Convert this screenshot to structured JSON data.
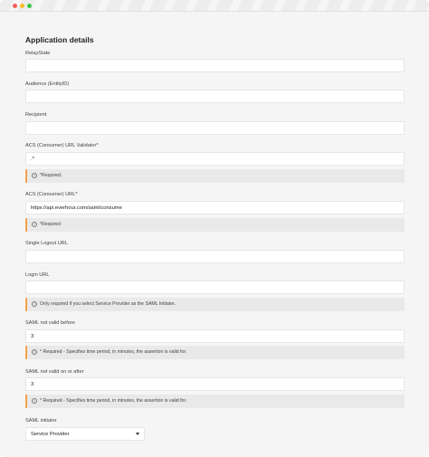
{
  "section_title": "Application details",
  "fields": {
    "relay_state": {
      "label": "RelayState",
      "value": ""
    },
    "audience": {
      "label": "Audience (EntityID)",
      "value": ""
    },
    "recipient": {
      "label": "Recipient",
      "value": ""
    },
    "acs_validator": {
      "label": "ACS (Consumer) URL Validator*",
      "value": ".*",
      "note": "*Required."
    },
    "acs_url": {
      "label": "ACS (Consumer) URL*",
      "value": "https://api.everhour.com/saml/consume",
      "note": "*Required"
    },
    "single_logout_url": {
      "label": "Single Logout URL",
      "value": ""
    },
    "login_url": {
      "label": "Login URL",
      "value": "",
      "note": "Only required if you select Service Provider as the SAML Initiater."
    },
    "saml_not_before": {
      "label": "SAML not valid before",
      "value": "3",
      "note": "* Required - Specifies time period, in minutes, the assertion is valid for."
    },
    "saml_not_after": {
      "label": "SAML not valid on or after",
      "value": "3",
      "note": "* Required - Specifies time period, in minutes, the assertion is valid for."
    },
    "saml_initiator": {
      "label": "SAML initiator",
      "selected": "Service Provider"
    }
  },
  "icons": {
    "info": "info-circle-icon",
    "dropdown": "caret-down-icon"
  },
  "colors": {
    "note_accent": "#f2a14a",
    "window_red": "#f25f58",
    "window_yellow": "#f9bd2e",
    "window_green": "#3ec645"
  }
}
